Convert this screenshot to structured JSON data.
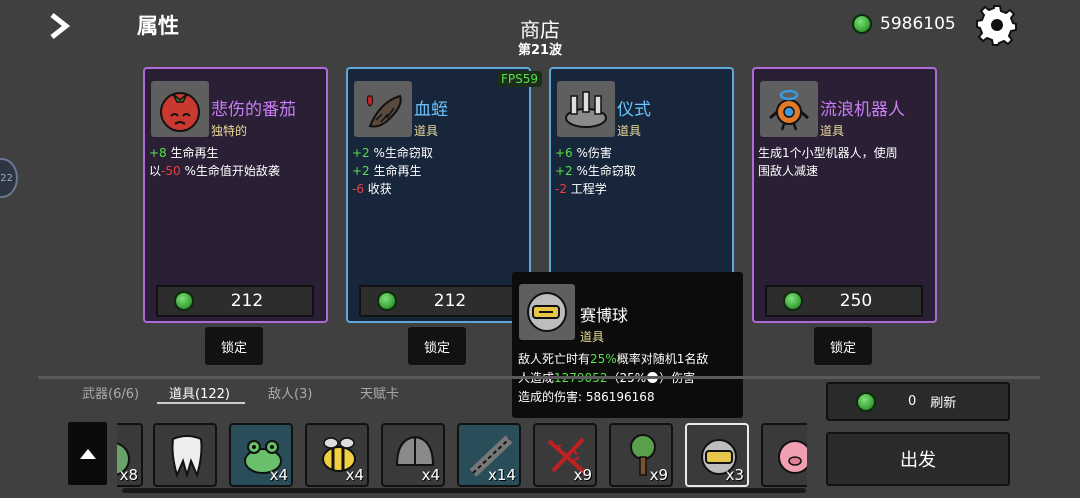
{
  "header": {
    "attributes_label": "属性",
    "shop_title": "商店",
    "wave_label": "第21波",
    "materials": "5986105"
  },
  "debug": {
    "fps": "FPS59"
  },
  "cards": [
    {
      "name": "悲伤的番茄",
      "tag": "独特的",
      "style": "purple",
      "icon": "tomato-icon",
      "stats": [
        {
          "parts": [
            {
              "t": "+8",
              "c": "g"
            },
            {
              "t": " 生命再生",
              "c": ""
            }
          ]
        },
        {
          "parts": [
            {
              "t": "以",
              "c": ""
            },
            {
              "t": "-50",
              "c": "r"
            },
            {
              "t": " %生命值开始敌袭",
              "c": ""
            }
          ]
        }
      ],
      "price": "212",
      "lock_label": "锁定"
    },
    {
      "name": "血蛭",
      "tag": "道具",
      "style": "blue",
      "icon": "leech-icon",
      "stats": [
        {
          "parts": [
            {
              "t": "+2",
              "c": "g"
            },
            {
              "t": " %生命窃取",
              "c": ""
            }
          ]
        },
        {
          "parts": [
            {
              "t": "+2",
              "c": "g"
            },
            {
              "t": " 生命再生",
              "c": ""
            }
          ]
        },
        {
          "parts": [
            {
              "t": "-6",
              "c": "r"
            },
            {
              "t": " 收获",
              "c": ""
            }
          ]
        }
      ],
      "price": "212",
      "lock_label": "锁定"
    },
    {
      "name": "仪式",
      "tag": "道具",
      "style": "blue",
      "icon": "ritual-icon",
      "stats": [
        {
          "parts": [
            {
              "t": "+6",
              "c": "g"
            },
            {
              "t": " %伤害",
              "c": ""
            }
          ]
        },
        {
          "parts": [
            {
              "t": "+2",
              "c": "g"
            },
            {
              "t": " %生命窃取",
              "c": ""
            }
          ]
        },
        {
          "parts": [
            {
              "t": "-2",
              "c": "r"
            },
            {
              "t": " 工程学",
              "c": ""
            }
          ]
        }
      ],
      "price": "",
      "lock_label": ""
    },
    {
      "name": "流浪机器人",
      "tag": "道具",
      "style": "purple",
      "icon": "robot-icon",
      "stats": [
        {
          "parts": [
            {
              "t": "生成1个小型机器人，使周",
              "c": ""
            }
          ]
        },
        {
          "parts": [
            {
              "t": "围敌人减速",
              "c": ""
            }
          ]
        }
      ],
      "price": "250",
      "lock_label": "锁定"
    }
  ],
  "tooltip": {
    "name": "赛博球",
    "tag": "道具",
    "line1_a": "敌人死亡时有",
    "line1_b": "25%",
    "line1_c": "概率对随机1名敌",
    "line2_a": "人造成",
    "line2_b": "1279052",
    "line2_c": "（25%",
    "line2_d": "）伤害",
    "line3_a": "造成的伤害: ",
    "line3_b": "586196168"
  },
  "tabs": [
    {
      "label": "武器(6/6)",
      "active": false
    },
    {
      "label": "道具(122)",
      "active": true
    },
    {
      "label": "敌人(3)",
      "active": false
    },
    {
      "label": "天赋卡",
      "active": false
    }
  ],
  "inventory": [
    {
      "icon": "partial-item-icon",
      "count": "x8"
    },
    {
      "icon": "tooth-icon",
      "count": ""
    },
    {
      "icon": "frog-icon",
      "count": "x4"
    },
    {
      "icon": "bee-icon",
      "count": "x4"
    },
    {
      "icon": "helmet-icon",
      "count": "x4"
    },
    {
      "icon": "chain-icon",
      "count": "x14"
    },
    {
      "icon": "thorn-icon",
      "count": "x9"
    },
    {
      "icon": "tree-icon",
      "count": "x9"
    },
    {
      "icon": "cyberball-icon",
      "count": "x3"
    },
    {
      "icon": "pig-icon",
      "count": ""
    }
  ],
  "refresh": {
    "count": "0",
    "label": "刷新"
  },
  "go_label": "出发"
}
